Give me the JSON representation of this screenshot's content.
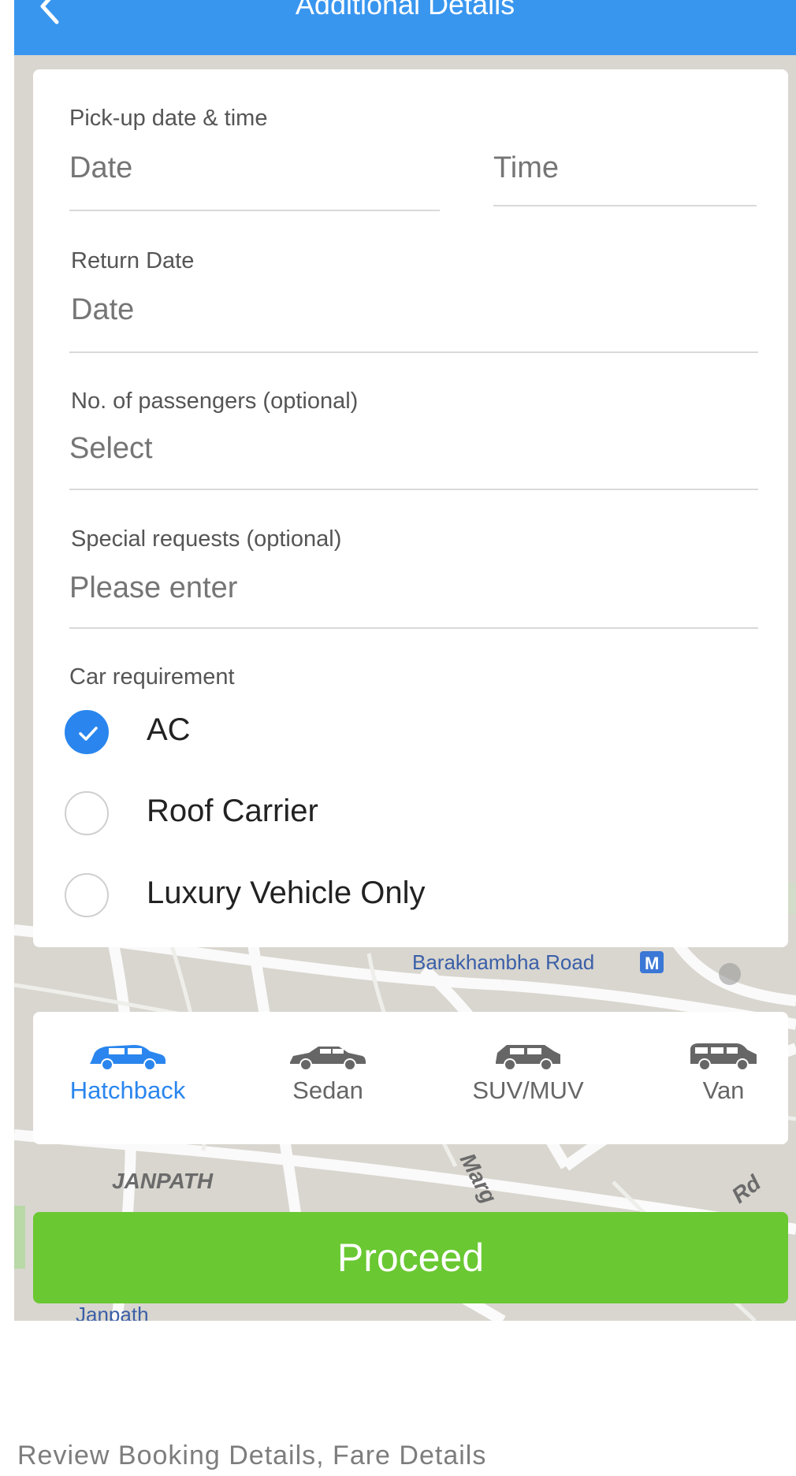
{
  "app_bar": {
    "title": "Additional Details",
    "back_icon": "chevron-left-icon"
  },
  "form": {
    "pickup": {
      "label": "Pick-up date & time",
      "date_placeholder": "Date",
      "time_placeholder": "Time"
    },
    "return_date": {
      "label": "Return Date",
      "placeholder": "Date"
    },
    "passengers": {
      "label": "No. of passengers (optional)",
      "placeholder": "Select"
    },
    "special_requests": {
      "label": "Special requests (optional)",
      "placeholder": "Please enter"
    },
    "car_requirement": {
      "label": "Car requirement",
      "options": [
        {
          "label": "AC",
          "checked": true
        },
        {
          "label": "Roof Carrier",
          "checked": false
        },
        {
          "label": "Luxury Vehicle Only",
          "checked": false
        }
      ]
    }
  },
  "vehicle_types": [
    {
      "label": "Hatchback",
      "selected": true,
      "icon": "hatchback-car-icon"
    },
    {
      "label": "Sedan",
      "selected": false,
      "icon": "sedan-car-icon"
    },
    {
      "label": "SUV/MUV",
      "selected": false,
      "icon": "suv-car-icon"
    },
    {
      "label": "Van",
      "selected": false,
      "icon": "van-icon"
    }
  ],
  "map_labels": {
    "barakhamba": "Barakhambha Road",
    "janpath_area": "JANPATH",
    "janpath_station": "Janpath",
    "marg": "Marg",
    "rd": "Rd",
    "metro_badge": "M"
  },
  "proceed_label": "Proceed",
  "caption": "Review Booking Details, Fare Details",
  "colors": {
    "primary": "#3996ef",
    "accent_blue": "#2a86ee",
    "proceed_green": "#6ac832"
  }
}
